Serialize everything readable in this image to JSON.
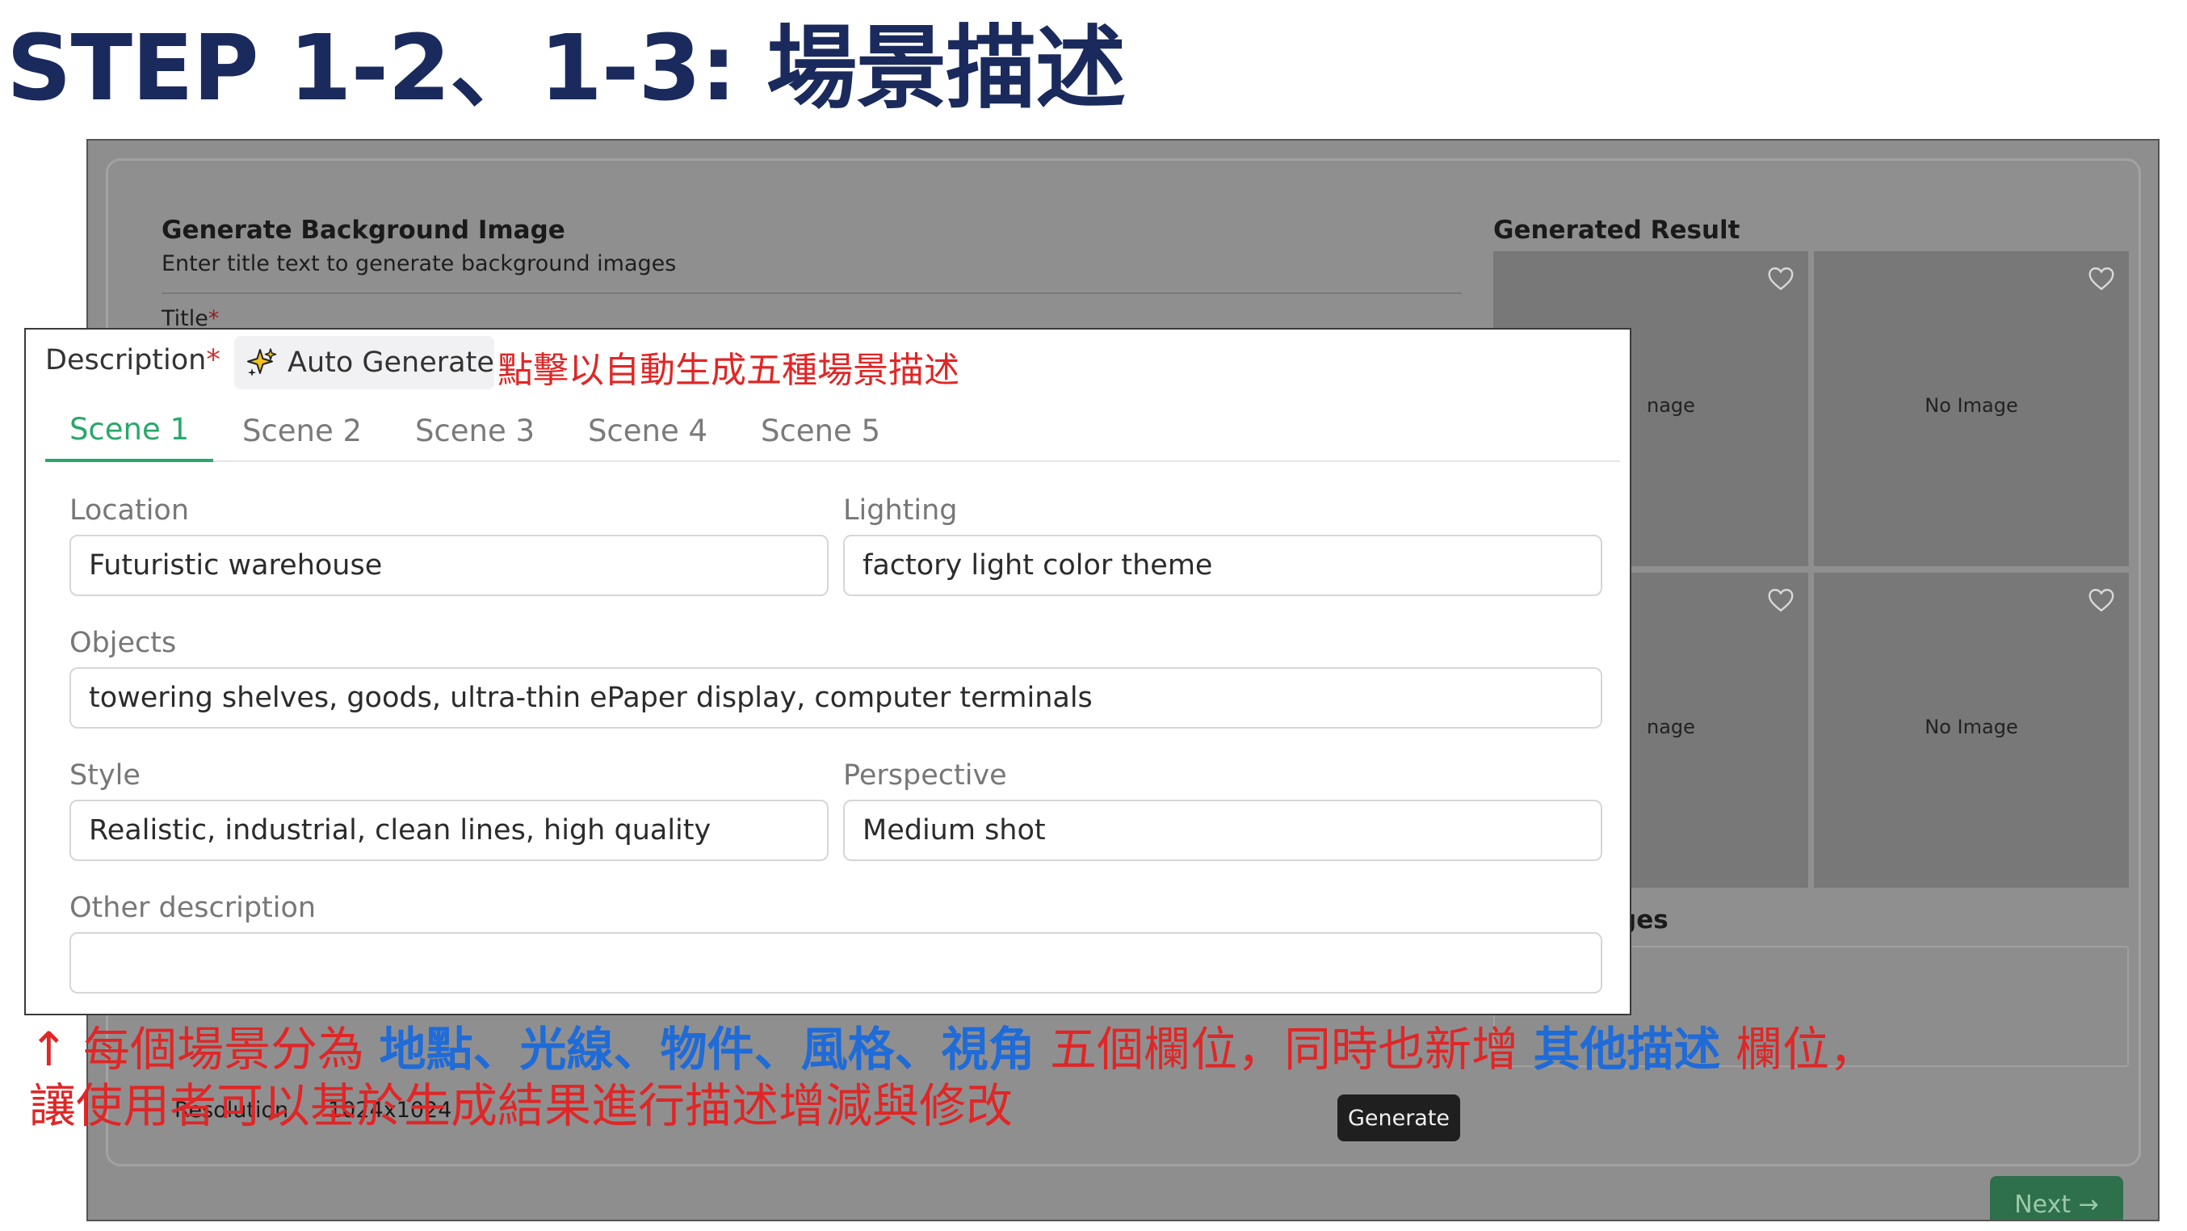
{
  "slide": {
    "title": "STEP 1-2、1-3: 場景描述"
  },
  "background_app": {
    "heading": "Generate Background Image",
    "subtext": "Enter title text to generate background images",
    "title_label": "Title",
    "required_mark": "*",
    "result_heading": "Generated Result",
    "tiles": [
      {
        "label": "No Image",
        "visible_label": "nage"
      },
      {
        "label": "No Image",
        "visible_label": "No Image"
      },
      {
        "label": "No Image",
        "visible_label": "nage"
      },
      {
        "label": "No Image",
        "visible_label": "No Image"
      }
    ],
    "partial_heading": "ges",
    "resolution_label": "Resolution",
    "resolution_value": "1024x1024",
    "generate_label": "Generate",
    "next_label": "Next →"
  },
  "panel": {
    "description_label": "Description",
    "required_mark": "*",
    "auto_generate_label": "Auto Generate",
    "auto_generate_icon": "sparkle-icon",
    "annotation": "點擊以自動生成五種場景描述",
    "tabs": [
      {
        "label": "Scene 1",
        "active": true
      },
      {
        "label": "Scene 2",
        "active": false
      },
      {
        "label": "Scene 3",
        "active": false
      },
      {
        "label": "Scene 4",
        "active": false
      },
      {
        "label": "Scene 5",
        "active": false
      }
    ],
    "fields": {
      "location": {
        "label": "Location",
        "value": "Futuristic warehouse"
      },
      "lighting": {
        "label": "Lighting",
        "value": "factory light color theme"
      },
      "objects": {
        "label": "Objects",
        "value": "towering shelves, goods, ultra-thin ePaper display, computer terminals"
      },
      "style": {
        "label": "Style",
        "value": "Realistic, industrial, clean lines, high quality"
      },
      "perspective": {
        "label": "Perspective",
        "value": "Medium shot"
      },
      "other": {
        "label": "Other description",
        "value": ""
      }
    }
  },
  "annotation_bottom": {
    "arrow": "↑",
    "part1": " 每個場景分為 ",
    "location": "地點",
    "sep1": "、",
    "lighting": "光線",
    "sep2": "、",
    "objects": "物件",
    "sep3": "、",
    "style": "風格",
    "sep4": "、",
    "perspective": "視角",
    "part2": " 五個欄位，同時也新增 ",
    "other": "其他描述",
    "part3": " 欄位，",
    "line2": "讓使用者可以基於生成結果進行描述增減與修改"
  },
  "colors": {
    "title": "#1a2a5c",
    "annotation_red": "#e02626",
    "annotation_blue": "#1f6bd8",
    "active_tab": "#28a86a",
    "next_button": "#2e6f4c"
  }
}
